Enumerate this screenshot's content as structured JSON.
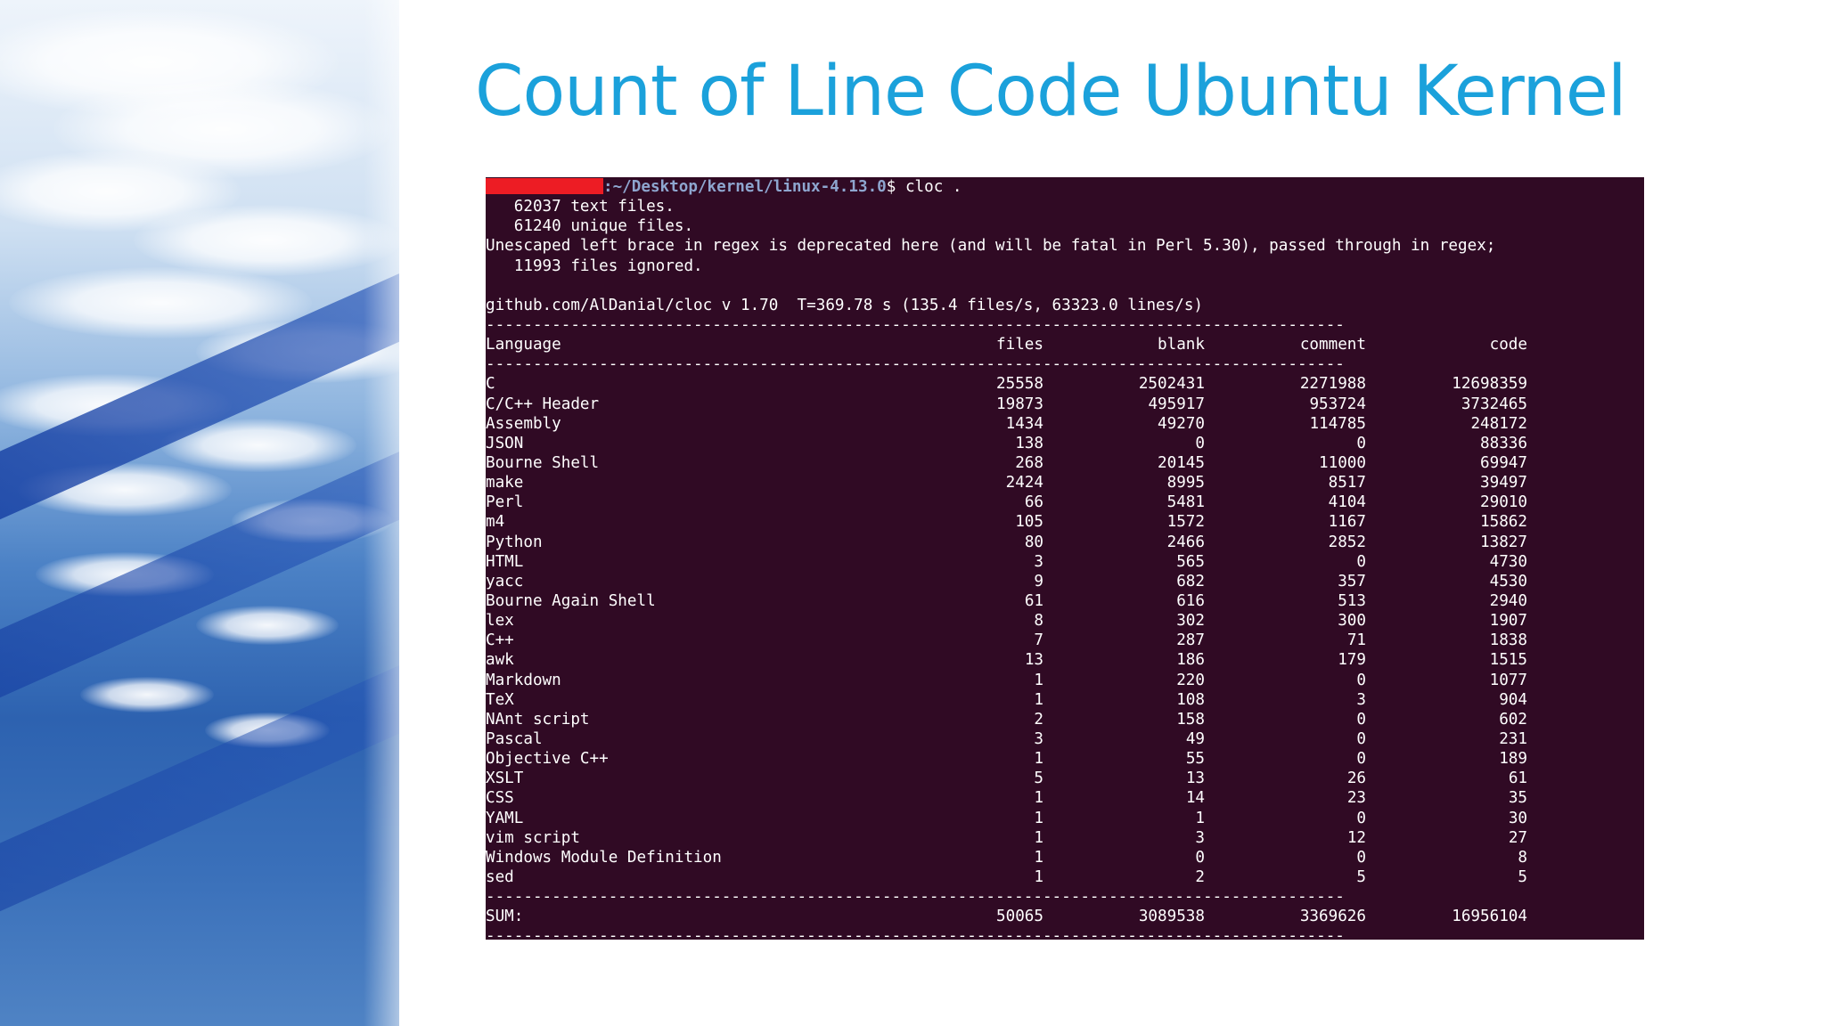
{
  "slide": {
    "title": "Count of Line Code Ubuntu Kernel"
  },
  "terminal": {
    "prompt_path": ":~/Desktop/kernel/linux-4.13.0",
    "prompt_symbol": "$",
    "command": " cloc .",
    "out_text_files": "   62037 text files.",
    "out_unique_files": "   61240 unique files.",
    "out_warning": "Unescaped left brace in regex is deprecated here (and will be fatal in Perl 5.30), passed through in regex;",
    "out_ignored": "   11993 files ignored.",
    "cloc_header": "github.com/AlDanial/cloc v 1.70  T=369.78 s (135.4 files/s, 63323.0 lines/s)",
    "separator": "-------------------------------------------------------------------------------------------",
    "columns": [
      "Language",
      "files",
      "blank",
      "comment",
      "code"
    ],
    "rows": [
      [
        "C",
        "25558",
        "2502431",
        "2271988",
        "12698359"
      ],
      [
        "C/C++ Header",
        "19873",
        "495917",
        "953724",
        "3732465"
      ],
      [
        "Assembly",
        "1434",
        "49270",
        "114785",
        "248172"
      ],
      [
        "JSON",
        "138",
        "0",
        "0",
        "88336"
      ],
      [
        "Bourne Shell",
        "268",
        "20145",
        "11000",
        "69947"
      ],
      [
        "make",
        "2424",
        "8995",
        "8517",
        "39497"
      ],
      [
        "Perl",
        "66",
        "5481",
        "4104",
        "29010"
      ],
      [
        "m4",
        "105",
        "1572",
        "1167",
        "15862"
      ],
      [
        "Python",
        "80",
        "2466",
        "2852",
        "13827"
      ],
      [
        "HTML",
        "3",
        "565",
        "0",
        "4730"
      ],
      [
        "yacc",
        "9",
        "682",
        "357",
        "4530"
      ],
      [
        "Bourne Again Shell",
        "61",
        "616",
        "513",
        "2940"
      ],
      [
        "lex",
        "8",
        "302",
        "300",
        "1907"
      ],
      [
        "C++",
        "7",
        "287",
        "71",
        "1838"
      ],
      [
        "awk",
        "13",
        "186",
        "179",
        "1515"
      ],
      [
        "Markdown",
        "1",
        "220",
        "0",
        "1077"
      ],
      [
        "TeX",
        "1",
        "108",
        "3",
        "904"
      ],
      [
        "NAnt script",
        "2",
        "158",
        "0",
        "602"
      ],
      [
        "Pascal",
        "3",
        "49",
        "0",
        "231"
      ],
      [
        "Objective C++",
        "1",
        "55",
        "0",
        "189"
      ],
      [
        "XSLT",
        "5",
        "13",
        "26",
        "61"
      ],
      [
        "CSS",
        "1",
        "14",
        "23",
        "35"
      ],
      [
        "YAML",
        "1",
        "1",
        "0",
        "30"
      ],
      [
        "vim script",
        "1",
        "3",
        "12",
        "27"
      ],
      [
        "Windows Module Definition",
        "1",
        "0",
        "0",
        "8"
      ],
      [
        "sed",
        "1",
        "2",
        "5",
        "5"
      ]
    ],
    "sum": [
      "SUM:",
      "50065",
      "3089538",
      "3369626",
      "16956104"
    ]
  },
  "colors": {
    "title": "#1ba1db",
    "terminal_bg": "#300a24",
    "prompt_path": "#8ea6cf",
    "redaction": "#ed1c24"
  }
}
